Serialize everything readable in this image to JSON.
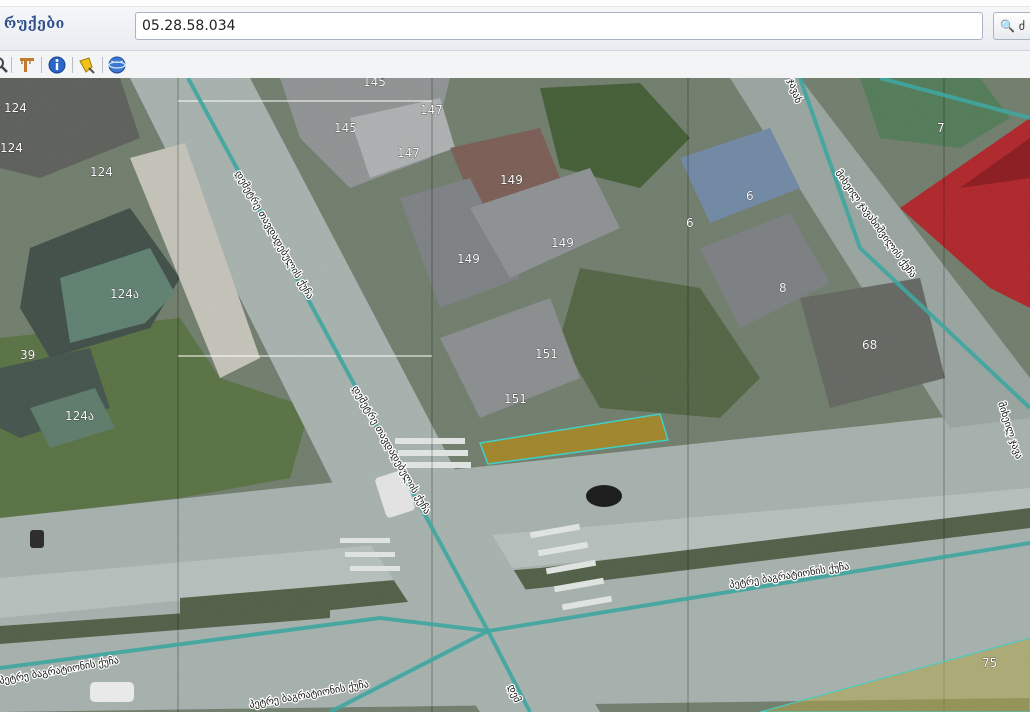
{
  "app": {
    "title": "რუქები"
  },
  "search": {
    "value": "05.28.58.034",
    "button_label": "ძ"
  },
  "toolbar": {
    "items": [
      "zoom-icon",
      "measure-icon",
      "info-icon",
      "highlight-icon",
      "globe-icon"
    ]
  },
  "map": {
    "parcel_labels": {
      "p124_1": "124",
      "p124_2": "124",
      "p124_3": "124",
      "p124a_1": "124ა",
      "p124a_2": "124ა",
      "p39": "39",
      "p145_1": "145",
      "p145_2": "145",
      "p147_1": "147",
      "p147_2": "147",
      "p149_1": "149",
      "p149_2": "149",
      "p149_3": "149",
      "p151_1": "151",
      "p151_2": "151",
      "p6_1": "6",
      "p6_2": "6",
      "p8": "8",
      "p68": "68",
      "p7": "7",
      "p75": "75"
    },
    "street_labels": {
      "petre_1": "პეტრე ბაგრატიონის ქუჩა",
      "petre_2": "პეტრე ბაგრატიონის ქუჩა",
      "petre_3": "პეტრე ბაგრატიონის ქუჩა",
      "diagonal_1": "დემეტრე თავდადებულის ქუჩა",
      "diagonal_2": "დემეტრე თავდადებულის ქუჩა",
      "diagonal_3": "დემ",
      "right_1": "მიხეილ ჯავახიშვილის ქუჩა",
      "right_2": "მიხეილ ჯავა",
      "top_frag": "ჯავახ"
    },
    "colors": {
      "road_line": "#3fa6a0",
      "highlight_fill": "#b08a1a",
      "highlight_stroke": "#3fd0c8"
    }
  }
}
